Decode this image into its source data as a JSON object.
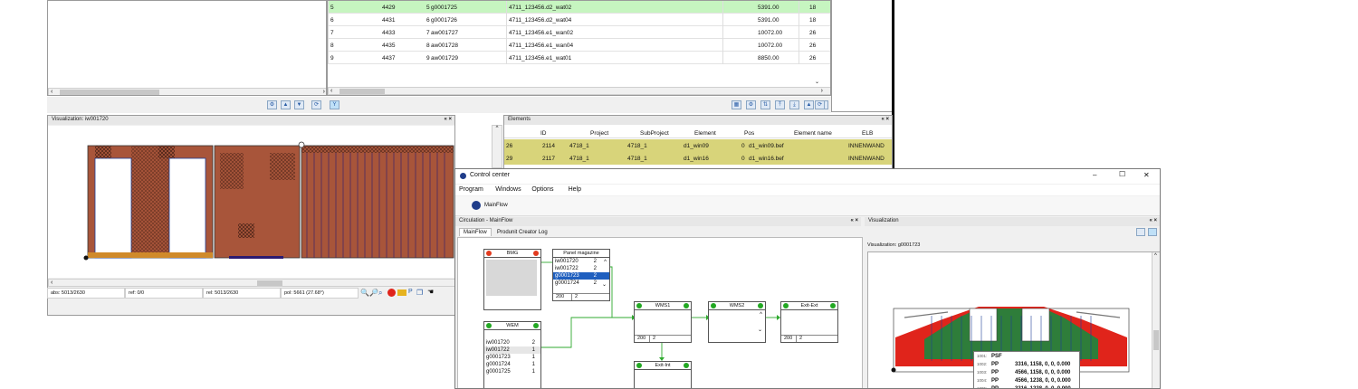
{
  "top_table": {
    "rows": [
      {
        "idx": "5",
        "id": "4429",
        "n": "5",
        "code": "g0001725",
        "name": "4711_123456.d2_wat02",
        "val": "5391.00",
        "last": "18",
        "hl": "green"
      },
      {
        "idx": "6",
        "id": "4431",
        "n": "6",
        "code": "g0001726",
        "name": "4711_123456.d2_wat04",
        "val": "5391.00",
        "last": "18",
        "hl": ""
      },
      {
        "idx": "7",
        "id": "4433",
        "n": "7",
        "code": "aw001727",
        "name": "4711_123456.e1_wan02",
        "val": "10072.00",
        "last": "26",
        "hl": ""
      },
      {
        "idx": "8",
        "id": "4435",
        "n": "8",
        "code": "aw001728",
        "name": "4711_123456.e1_wan04",
        "val": "10072.00",
        "last": "26",
        "hl": ""
      },
      {
        "idx": "9",
        "id": "4437",
        "n": "9",
        "code": "aw001729",
        "name": "4711_123456.e1_wat01",
        "val": "8850.00",
        "last": "26",
        "hl": ""
      }
    ]
  },
  "visualization_panel": {
    "title": "Visualization: iw001720",
    "controls": "« ×",
    "status": {
      "abs": "abs: 5013/2630",
      "ref": "ref: 0/0",
      "rel": "rel: 5013/2630",
      "pol": "pol: 5661 (27.68°)"
    }
  },
  "elements_panel": {
    "title": "Elements",
    "controls": "« ×",
    "columns": [
      "ID",
      "Project",
      "SubProject",
      "Element",
      "Pos",
      "Element name",
      "ELB"
    ],
    "rows": [
      {
        "idx": "26",
        "id": "2114",
        "project": "4718_1",
        "subproject": "4718_1",
        "element": "d1_win09",
        "pos": "0",
        "element_name": "d1_win09.bef",
        "elb": "INNENWAND"
      },
      {
        "idx": "29",
        "id": "2117",
        "project": "4718_1",
        "subproject": "4718_1",
        "element": "d1_win16",
        "pos": "0",
        "element_name": "d1_win16.bef",
        "elb": "INNENWAND"
      }
    ]
  },
  "control_center": {
    "title": "Control center",
    "window_controls": {
      "minimize": "–",
      "maximize": "☐",
      "close": "✕"
    },
    "menu": [
      "Program",
      "Windows",
      "Options",
      "Help"
    ],
    "toolbar_label": "MainFlow",
    "circulation": {
      "title": "Circulation - MainFlow",
      "controls": "« ×",
      "tabs": [
        "MainFlow",
        "Produnit Creator Log"
      ],
      "nodes": {
        "bmg": {
          "title": "BMG"
        },
        "panel_magazine": {
          "title": "Panel magazine",
          "items": [
            {
              "code": "iw001720",
              "qty": "2"
            },
            {
              "code": "iw001722",
              "qty": "2"
            },
            {
              "code": "g0001723",
              "qty": "2"
            },
            {
              "code": "g0001724",
              "qty": "2"
            }
          ],
          "foot_a": "200",
          "foot_b": "2"
        },
        "wem": {
          "title": "WEM",
          "items": [
            {
              "code": "iw001720",
              "qty": "2"
            },
            {
              "code": "iw001722",
              "qty": "1"
            },
            {
              "code": "g0001723",
              "qty": "1"
            },
            {
              "code": "g0001724",
              "qty": "1"
            },
            {
              "code": "g0001725",
              "qty": "1"
            }
          ]
        },
        "wms1": {
          "title": "WMS1",
          "foot_a": "200",
          "foot_b": "2"
        },
        "wms2": {
          "title": "WMS2"
        },
        "exit_ext": {
          "title": "Exit-Ext",
          "foot_a": "200",
          "foot_b": "2"
        },
        "exit_int": {
          "title": "Exit-Int"
        }
      }
    },
    "visualization": {
      "header": "Visualization",
      "controls": "« ×",
      "title": "Visualization: g0001723",
      "tooltip": [
        {
          "n": "1001:",
          "type": "PSF",
          "coords": ""
        },
        {
          "n": "1002:",
          "type": "PP",
          "coords": "3316, 1158, 0, 0, 0.000"
        },
        {
          "n": "1003:",
          "type": "PP",
          "coords": "4566, 1158, 0, 0, 0.000"
        },
        {
          "n": "1004:",
          "type": "PP",
          "coords": "4566, 1238, 0, 0, 0.000"
        },
        {
          "n": "1005:",
          "type": "PP",
          "coords": "3316, 1238, 0, 0, 0.000"
        }
      ]
    }
  },
  "colors": {
    "highlight_green": "#c6f5c0",
    "highlight_olive": "#d8d47a",
    "selection_blue": "#1f5fbf",
    "panel_wood": "#a8553a",
    "roof_red": "#e0241b",
    "roof_green": "#2e7d3a"
  }
}
